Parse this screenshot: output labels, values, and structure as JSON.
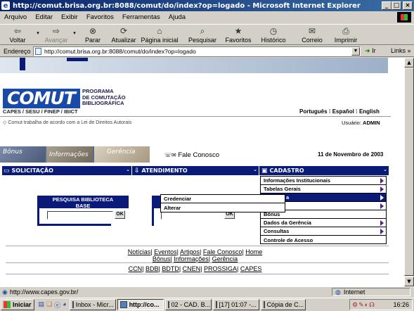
{
  "window": {
    "title": "http://comut.brisa.org.br:8088/comut/do/index?op=logado - Microsoft Internet Explorer",
    "min": "_",
    "max": "□",
    "close": "×"
  },
  "menubar": [
    "Arquivo",
    "Editar",
    "Exibir",
    "Favoritos",
    "Ferramentas",
    "Ajuda"
  ],
  "toolbar": {
    "back": "Voltar",
    "forward": "Avançar",
    "stop": "Parar",
    "refresh": "Atualizar",
    "home": "Página inicial",
    "search": "Pesquisar",
    "favorites": "Favoritos",
    "history": "Histórico",
    "mail": "Correio",
    "print": "Imprimir"
  },
  "address": {
    "label": "Endereço",
    "url": "http://comut.brisa.org.br:8088/comut/do/index?op=logado",
    "go": "Ir",
    "links": "Links »"
  },
  "site": {
    "logo_text": "COMUT",
    "program_line1": "PROGRAMA",
    "program_line2": "DE COMUTAÇÃO",
    "program_line3": "BIBLIOGRÁFICA",
    "sponsors": "CAPES / SESU / FINEP / IBICT",
    "languages": [
      "Português",
      "Español",
      "English"
    ],
    "law_notice": "Comut trabalha de acordo com a Lei de Direitos Autorais",
    "user_label": "Usuário:",
    "user_name": "ADMIN",
    "banner_tabs": [
      "Bônus",
      "Informações",
      "Gerência"
    ],
    "contact": "Fale Conosco",
    "date": "11 de Novembro de 2003",
    "nav": [
      "SOLICITAÇÃO",
      "ATENDIMENTO",
      "CADASTRO"
    ],
    "search_box": {
      "title_line1": "PESQUISA BIBLIOTECA",
      "title_line2": "BASE",
      "ok": "OK"
    },
    "ok2": "OK",
    "cadastro_menu": [
      {
        "label": "Informações Institucionais",
        "arrow": true
      },
      {
        "label": "Tabelas Gerais",
        "arrow": true
      },
      {
        "label": "a",
        "arrow": true
      },
      {
        "label": "",
        "arrow": true
      },
      {
        "label": "Bônus",
        "arrow": false
      },
      {
        "label": "Dados da Gerência",
        "arrow": true
      },
      {
        "label": "Consultas",
        "arrow": true
      },
      {
        "label": "Controle de Acesso",
        "arrow": false
      }
    ],
    "submenu": [
      "Credenciar",
      "Alterar"
    ],
    "footer_links1": [
      "Notícias",
      "Eventos",
      "Artigos",
      "Fale Conosco",
      "Home"
    ],
    "footer_links2": [
      "Bônus",
      "Informações",
      "Gerência"
    ],
    "footer_links3": [
      "CCN",
      "BDB",
      "BDTD",
      "CNEN",
      "PROSSIGA",
      "CAPES"
    ]
  },
  "status": {
    "url": "http://www.capes.gov.br/",
    "zone": "Internet"
  },
  "taskbar": {
    "start": "Iniciar",
    "tasks": [
      "Inbox - Micr...",
      "http://co...",
      "02 - CAD. B...",
      "[17] 01:07 -...",
      "Cópia de C..."
    ],
    "clock": "16:26"
  }
}
